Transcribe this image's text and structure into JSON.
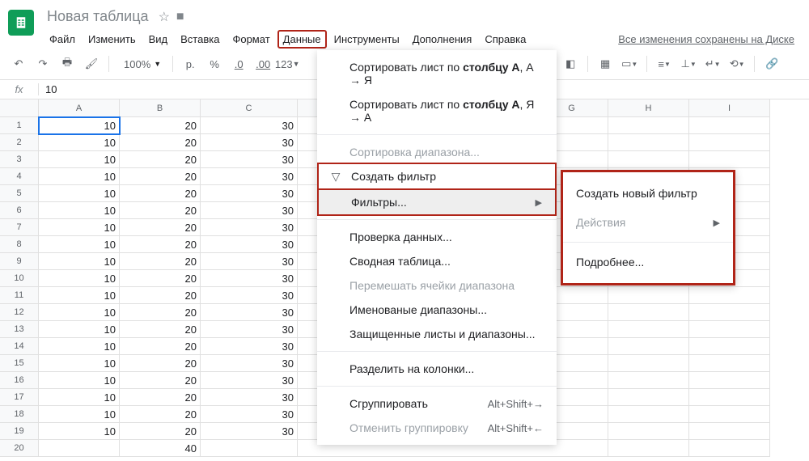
{
  "header": {
    "title": "Новая таблица",
    "saved_text": "Все изменения сохранены на Диске"
  },
  "menu": {
    "file": "Файл",
    "edit": "Изменить",
    "view": "Вид",
    "insert": "Вставка",
    "format": "Формат",
    "data": "Данные",
    "tools": "Инструменты",
    "addons": "Дополнения",
    "help": "Справка"
  },
  "toolbar": {
    "zoom": "100%",
    "currency": "р.",
    "percent": "%",
    "dec_dec": ".0",
    "inc_dec": ".00",
    "format_num": "123"
  },
  "formula": {
    "value": "10"
  },
  "columns": [
    "A",
    "B",
    "C",
    "G",
    "H",
    "I"
  ],
  "rows": [
    {
      "n": "1",
      "a": "10",
      "b": "20",
      "c": "30"
    },
    {
      "n": "2",
      "a": "10",
      "b": "20",
      "c": "30"
    },
    {
      "n": "3",
      "a": "10",
      "b": "20",
      "c": "30"
    },
    {
      "n": "4",
      "a": "10",
      "b": "20",
      "c": "30"
    },
    {
      "n": "5",
      "a": "10",
      "b": "20",
      "c": "30"
    },
    {
      "n": "6",
      "a": "10",
      "b": "20",
      "c": "30"
    },
    {
      "n": "7",
      "a": "10",
      "b": "20",
      "c": "30"
    },
    {
      "n": "8",
      "a": "10",
      "b": "20",
      "c": "30"
    },
    {
      "n": "9",
      "a": "10",
      "b": "20",
      "c": "30"
    },
    {
      "n": "10",
      "a": "10",
      "b": "20",
      "c": "30"
    },
    {
      "n": "11",
      "a": "10",
      "b": "20",
      "c": "30"
    },
    {
      "n": "12",
      "a": "10",
      "b": "20",
      "c": "30"
    },
    {
      "n": "13",
      "a": "10",
      "b": "20",
      "c": "30"
    },
    {
      "n": "14",
      "a": "10",
      "b": "20",
      "c": "30"
    },
    {
      "n": "15",
      "a": "10",
      "b": "20",
      "c": "30"
    },
    {
      "n": "16",
      "a": "10",
      "b": "20",
      "c": "30"
    },
    {
      "n": "17",
      "a": "10",
      "b": "20",
      "c": "30"
    },
    {
      "n": "18",
      "a": "10",
      "b": "20",
      "c": "30"
    },
    {
      "n": "19",
      "a": "10",
      "b": "20",
      "c": "30"
    },
    {
      "n": "20",
      "a": "",
      "b": "40",
      "c": ""
    }
  ],
  "dropdown": {
    "sort_asc_pre": "Сортировать лист по ",
    "sort_asc_bold": "столбцу A",
    "sort_asc_suf": ", А → Я",
    "sort_desc_pre": "Сортировать лист по ",
    "sort_desc_bold": "столбцу A",
    "sort_desc_suf": ", Я → А",
    "sort_range": "Сортировка диапазона...",
    "create_filter": "Создать фильтр",
    "filters": "Фильтры...",
    "data_validation": "Проверка данных...",
    "pivot": "Сводная таблица...",
    "shuffle": "Перемешать ячейки диапазона",
    "named_ranges": "Именованые диапазоны...",
    "protected": "Защищенные листы и диапазоны...",
    "split": "Разделить на колонки...",
    "group": "Сгруппировать",
    "group_short": "Alt+Shift+→",
    "ungroup": "Отменить группировку",
    "ungroup_short": "Alt+Shift+←"
  },
  "submenu": {
    "create_new": "Создать новый фильтр",
    "actions": "Действия",
    "more": "Подробнее..."
  }
}
